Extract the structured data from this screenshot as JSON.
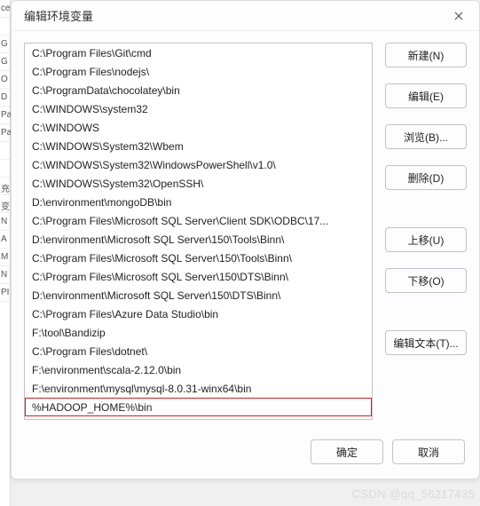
{
  "leftEdge": [
    "ce",
    "",
    "G",
    "G",
    "O",
    "D",
    "Pa",
    "Pa",
    "",
    "",
    "充",
    "变",
    "N",
    "A",
    "M",
    "N",
    "PI"
  ],
  "dialog": {
    "title": "编辑环境变量",
    "listItems": [
      "C:\\Program Files\\Git\\cmd",
      "C:\\Program Files\\nodejs\\",
      "C:\\ProgramData\\chocolatey\\bin",
      "C:\\WINDOWS\\system32",
      "C:\\WINDOWS",
      "C:\\WINDOWS\\System32\\Wbem",
      "C:\\WINDOWS\\System32\\WindowsPowerShell\\v1.0\\",
      "C:\\WINDOWS\\System32\\OpenSSH\\",
      "D:\\environment\\mongoDB\\bin",
      "C:\\Program Files\\Microsoft SQL Server\\Client SDK\\ODBC\\17...",
      "D:\\environment\\Microsoft SQL Server\\150\\Tools\\Binn\\",
      "C:\\Program Files\\Microsoft SQL Server\\150\\Tools\\Binn\\",
      "C:\\Program Files\\Microsoft SQL Server\\150\\DTS\\Binn\\",
      "D:\\environment\\Microsoft SQL Server\\150\\DTS\\Binn\\",
      "C:\\Program Files\\Azure Data Studio\\bin",
      "F:\\tool\\Bandizip",
      "C:\\Program Files\\dotnet\\",
      "F:\\environment\\scala-2.12.0\\bin",
      "F:\\environment\\mysql\\mysql-8.0.31-winx64\\bin",
      "%HADOOP_HOME%\\bin"
    ],
    "highlightedIndex": 19,
    "buttons": {
      "new": "新建(N)",
      "edit": "编辑(E)",
      "browse": "浏览(B)...",
      "delete": "删除(D)",
      "moveUp": "上移(U)",
      "moveDown": "下移(O)",
      "editText": "编辑文本(T)...",
      "ok": "确定",
      "cancel": "取消"
    }
  },
  "watermark": "CSDN @qq_56217435"
}
